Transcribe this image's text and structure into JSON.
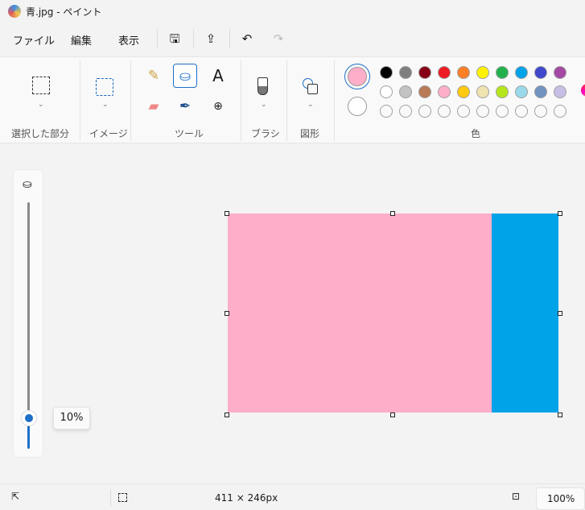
{
  "title": "青.jpg - ペイント",
  "menu": {
    "file": "ファイル",
    "edit": "編集",
    "view": "表示"
  },
  "toolbar": {
    "save": "save-icon",
    "share": "share-icon",
    "undo": "undo-icon",
    "redo": "redo-icon"
  },
  "ribbon": {
    "groups": {
      "selection": "選択した部分",
      "image": "イメージ",
      "tools": "ツール",
      "brush": "ブラシ",
      "shapes": "図形",
      "colors": "色"
    },
    "active_tool": "fill",
    "text_tool_glyph": "A",
    "primary_color": "#ffaec9",
    "secondary_color": "#ffffff",
    "palette": [
      [
        "#000000",
        "#7f7f7f",
        "#880015",
        "#ed1c24",
        "#ff7f27",
        "#fff200",
        "#22b14c",
        "#00a2e8",
        "#3f48cc",
        "#a349a4"
      ],
      [
        "#ffffff",
        "#c3c3c3",
        "#b97a57",
        "#ffaec9",
        "#ffc90e",
        "#efe4b0",
        "#b5e61d",
        "#99d9ea",
        "#7092be",
        "#c8bfe7"
      ],
      [
        "",
        "",
        "",
        "",
        "",
        "",
        "",
        "",
        "",
        ""
      ]
    ]
  },
  "slider": {
    "label": "10%",
    "value": 10
  },
  "canvas": {
    "left_color": "#ffaec9",
    "right_color": "#00a2e8"
  },
  "status": {
    "size": "411 × 246px",
    "zoom": "100%"
  }
}
